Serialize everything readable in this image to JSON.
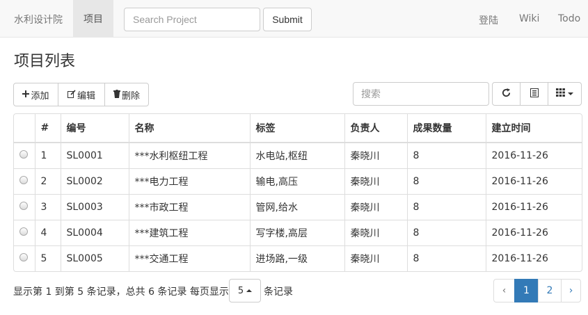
{
  "navbar": {
    "brand": "水利设计院",
    "active_item": "项目",
    "search_placeholder": "Search Project",
    "submit_label": "Submit",
    "right_items": [
      "登陆",
      "Wiki",
      "Todo"
    ]
  },
  "page_title": "项目列表",
  "toolbar": {
    "add_label": "添加",
    "edit_label": "编辑",
    "delete_label": "删除",
    "search_placeholder": "搜索",
    "refresh_icon": "refresh-icon",
    "toggle_icon": "list-view-icon",
    "columns_icon": "grid-columns-icon"
  },
  "table": {
    "headers": [
      "#",
      "编号",
      "名称",
      "标签",
      "负责人",
      "成果数量",
      "建立时间"
    ],
    "rows": [
      [
        "1",
        "SL0001",
        "***水利枢纽工程",
        "水电站,枢纽",
        "秦晓川",
        "8",
        "2016-11-26"
      ],
      [
        "2",
        "SL0002",
        "***电力工程",
        "输电,高压",
        "秦晓川",
        "8",
        "2016-11-26"
      ],
      [
        "3",
        "SL0003",
        "***市政工程",
        "管网,给水",
        "秦晓川",
        "8",
        "2016-11-26"
      ],
      [
        "4",
        "SL0004",
        "***建筑工程",
        "写字楼,高层",
        "秦晓川",
        "8",
        "2016-11-26"
      ],
      [
        "5",
        "SL0005",
        "***交通工程",
        "进场路,一级",
        "秦晓川",
        "8",
        "2016-11-26"
      ]
    ]
  },
  "footer": {
    "info": "显示第 1 到第 5 条记录，总共 6 条记录 每页显示",
    "page_size": "5",
    "suffix": "条记录",
    "pagination": {
      "prev": "‹",
      "pages": [
        "1",
        "2"
      ],
      "next": "›",
      "active_page": "1"
    }
  },
  "colors": {
    "primary": "#337ab7",
    "navbar_bg": "#f8f8f8",
    "border": "#dddddd"
  }
}
